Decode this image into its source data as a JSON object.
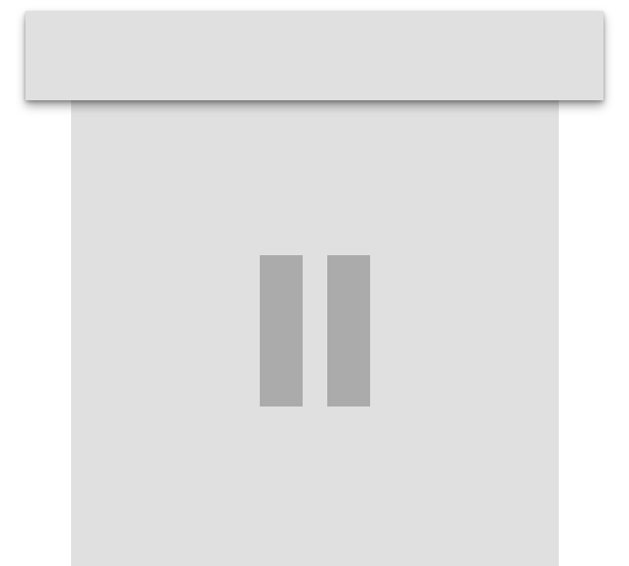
{
  "icon": {
    "name": "trash-bin-icon",
    "colors": {
      "background": "#ffffff",
      "bin": "#e0e0e0",
      "slots": "#ababab"
    }
  }
}
